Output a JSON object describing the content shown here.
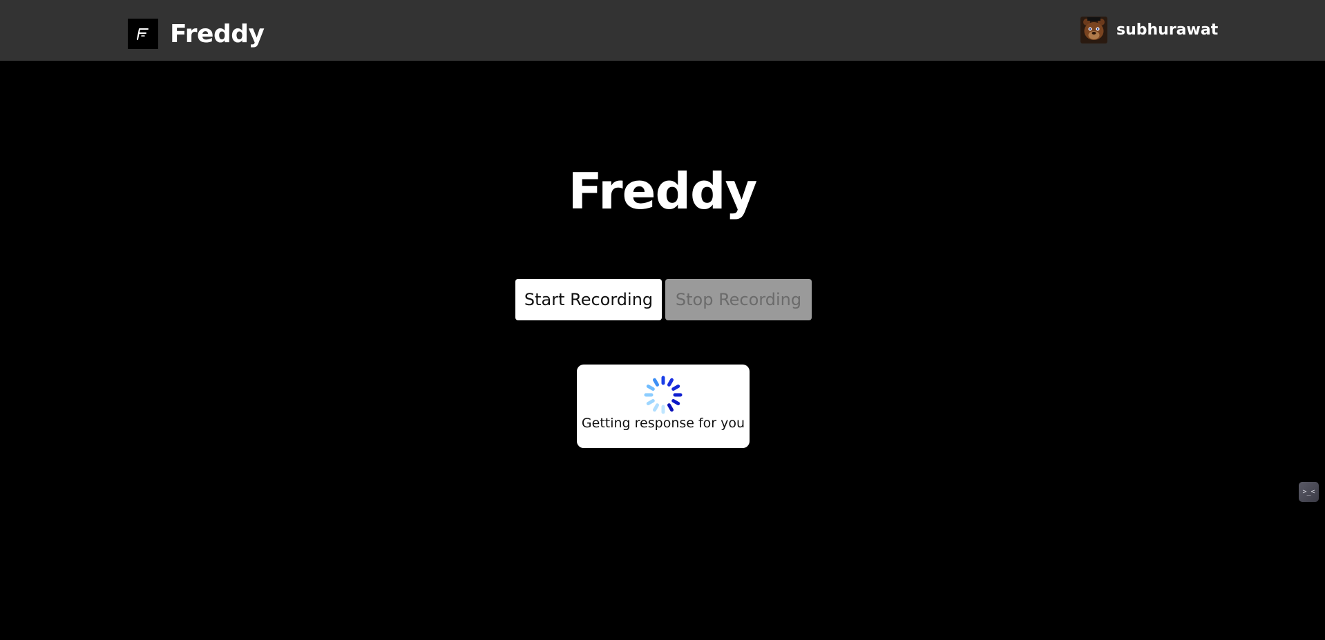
{
  "header": {
    "brand_title": "Freddy",
    "username": "subhurawat",
    "avatar_icon": "bear-avatar-icon",
    "logo_icon": "freddy-logo-icon"
  },
  "main": {
    "title": "Freddy",
    "start_button_label": "Start Recording",
    "stop_button_label": "Stop Recording",
    "loading_text": "Getting response for you",
    "spinner_icon": "loading-spinner-icon"
  },
  "floating": {
    "extension_icon": "terminal-extension-icon",
    "extension_label": ">_<"
  },
  "colors": {
    "navbar_bg": "#333333",
    "page_bg": "#000000",
    "spinner_dark": "#0a1fd8",
    "spinner_light": "#8fd0ff"
  }
}
